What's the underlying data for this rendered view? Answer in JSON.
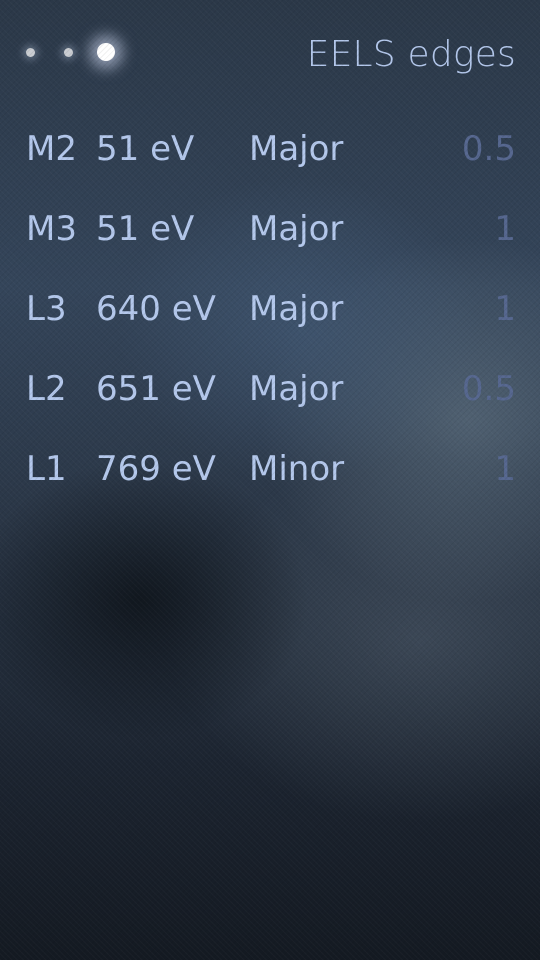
{
  "header": {
    "title": "EELS edges",
    "pulley_icon": "pulley-menu-dots"
  },
  "edges": [
    {
      "shell": "M2",
      "energy": "51 eV",
      "type": "Major",
      "weight": "0.5"
    },
    {
      "shell": "M3",
      "energy": "51 eV",
      "type": "Major",
      "weight": "1"
    },
    {
      "shell": "L3",
      "energy": "640 eV",
      "type": "Major",
      "weight": "1"
    },
    {
      "shell": "L2",
      "energy": "651 eV",
      "type": "Major",
      "weight": "0.5"
    },
    {
      "shell": "L1",
      "energy": "769 eV",
      "type": "Minor",
      "weight": "1"
    }
  ],
  "colors": {
    "primary_text": "#b4c8ec",
    "secondary_text": "#56678f"
  }
}
